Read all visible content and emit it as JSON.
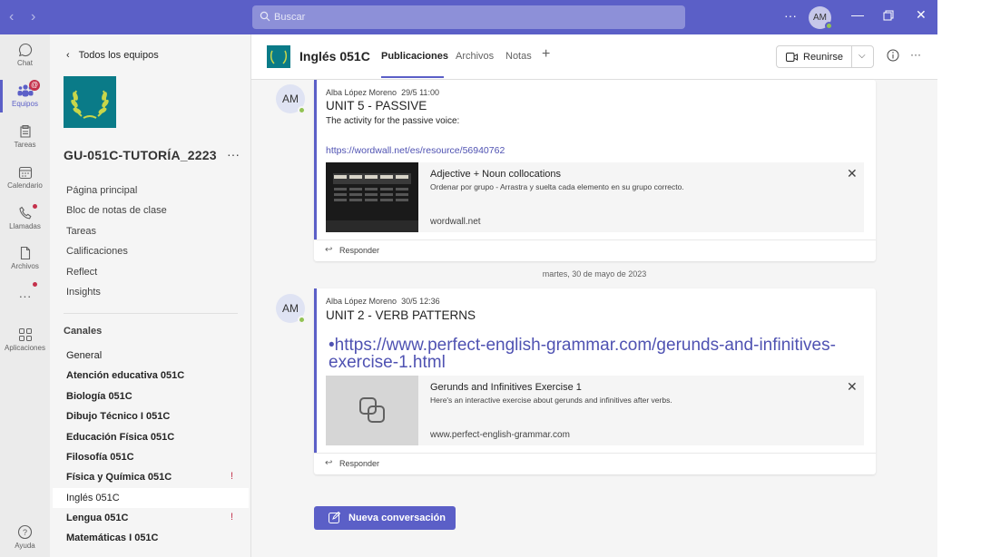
{
  "titlebar": {
    "search_placeholder": "Buscar",
    "avatar_initials": "AM",
    "more": "···"
  },
  "rail": {
    "items": [
      {
        "label": "Chat",
        "icon": "chat-icon"
      },
      {
        "label": "Equipos",
        "icon": "teams-icon",
        "badge": "@"
      },
      {
        "label": "Tareas",
        "icon": "assignments-icon"
      },
      {
        "label": "Calendario",
        "icon": "calendar-icon"
      },
      {
        "label": "Llamadas",
        "icon": "calls-icon"
      },
      {
        "label": "Archivos",
        "icon": "files-icon"
      },
      {
        "label": "···",
        "icon": "more-apps-icon"
      },
      {
        "label": "Aplicaciones",
        "icon": "apps-icon"
      },
      {
        "label": "Ayuda",
        "icon": "help-icon"
      }
    ]
  },
  "sidebar": {
    "back_label": "Todos los equipos",
    "team_name": "GU-051C-TUTORÍA_2223",
    "team_more": "···",
    "nav": [
      "Página principal",
      "Bloc de notas de clase",
      "Tareas",
      "Calificaciones",
      "Reflect",
      "Insights"
    ],
    "channels_title": "Canales",
    "channels": [
      {
        "name": "General",
        "bold": false
      },
      {
        "name": "Atención educativa 051C",
        "bold": true
      },
      {
        "name": "Biología 051C",
        "bold": true
      },
      {
        "name": "Dibujo Técnico I 051C",
        "bold": true
      },
      {
        "name": "Educación Física 051C",
        "bold": true
      },
      {
        "name": "Filosofía 051C",
        "bold": true
      },
      {
        "name": "Física y Química 051C",
        "bold": true,
        "alert": true
      },
      {
        "name": "Inglés 051C",
        "bold": false,
        "selected": true
      },
      {
        "name": "Lengua 051C",
        "bold": true,
        "alert": true
      },
      {
        "name": "Matemáticas I 051C",
        "bold": true
      }
    ]
  },
  "header": {
    "title": "Inglés 051C",
    "tabs": [
      "Publicaciones",
      "Archivos",
      "Notas"
    ],
    "add_tab": "+",
    "meet_label": "Reunirse",
    "more": "···"
  },
  "posts": [
    {
      "avatar": "AM",
      "author": "Alba López Moreno",
      "time": "29/5 11:00",
      "subject": "UNIT 5 - PASSIVE",
      "body": "The activity for the passive voice:",
      "link": "https://wordwall.net/es/resource/56940762",
      "card": {
        "title": "Adjective + Noun collocations",
        "description": "Ordenar por grupo - Arrastra y suelta cada elemento en su grupo correcto.",
        "domain": "wordwall.net"
      },
      "reply": "Responder"
    },
    {
      "avatar": "AM",
      "author": "Alba López Moreno",
      "time": "30/5 12:36",
      "subject": "UNIT 2 - VERB PATTERNS",
      "link": "•https://www.perfect-english-grammar.com/gerunds-and-infinitives-exercise-1.html",
      "card": {
        "title": "Gerunds and Infinitives Exercise 1",
        "description": "Here's an interactive exercise about gerunds and infinitives after verbs.",
        "domain": "www.perfect-english-grammar.com"
      },
      "reply": "Responder"
    }
  ],
  "date_separator": "martes, 30 de mayo de 2023",
  "new_conversation": "Nueva conversación",
  "colors": {
    "brand": "#5b5fc7",
    "team_logo": "#0a7b88",
    "presence": "#92c353",
    "alert": "#c4314b"
  }
}
